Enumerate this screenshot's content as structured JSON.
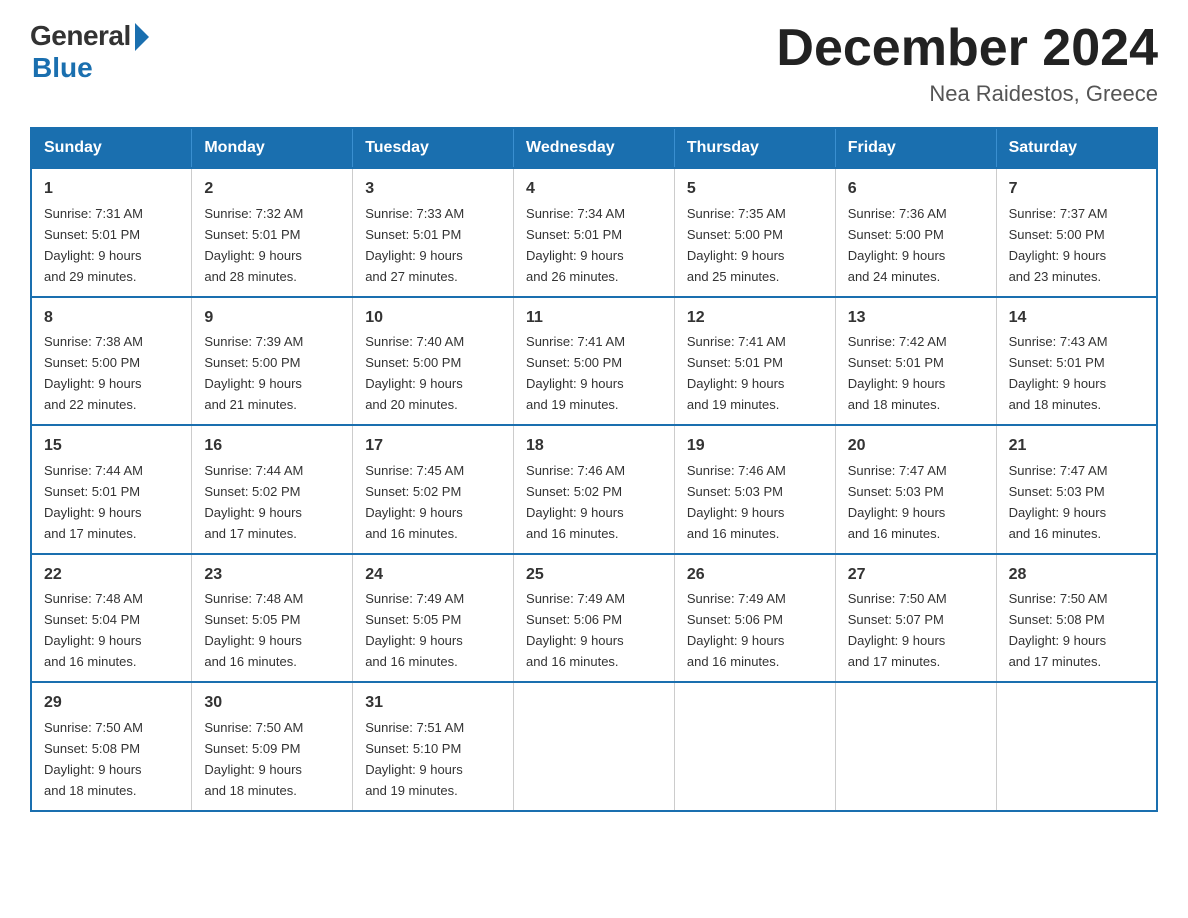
{
  "header": {
    "logo_general": "General",
    "logo_blue": "Blue",
    "month_title": "December 2024",
    "location": "Nea Raidestos, Greece"
  },
  "weekdays": [
    "Sunday",
    "Monday",
    "Tuesday",
    "Wednesday",
    "Thursday",
    "Friday",
    "Saturday"
  ],
  "weeks": [
    [
      {
        "day": "1",
        "sunrise": "7:31 AM",
        "sunset": "5:01 PM",
        "daylight": "9 hours and 29 minutes."
      },
      {
        "day": "2",
        "sunrise": "7:32 AM",
        "sunset": "5:01 PM",
        "daylight": "9 hours and 28 minutes."
      },
      {
        "day": "3",
        "sunrise": "7:33 AM",
        "sunset": "5:01 PM",
        "daylight": "9 hours and 27 minutes."
      },
      {
        "day": "4",
        "sunrise": "7:34 AM",
        "sunset": "5:01 PM",
        "daylight": "9 hours and 26 minutes."
      },
      {
        "day": "5",
        "sunrise": "7:35 AM",
        "sunset": "5:00 PM",
        "daylight": "9 hours and 25 minutes."
      },
      {
        "day": "6",
        "sunrise": "7:36 AM",
        "sunset": "5:00 PM",
        "daylight": "9 hours and 24 minutes."
      },
      {
        "day": "7",
        "sunrise": "7:37 AM",
        "sunset": "5:00 PM",
        "daylight": "9 hours and 23 minutes."
      }
    ],
    [
      {
        "day": "8",
        "sunrise": "7:38 AM",
        "sunset": "5:00 PM",
        "daylight": "9 hours and 22 minutes."
      },
      {
        "day": "9",
        "sunrise": "7:39 AM",
        "sunset": "5:00 PM",
        "daylight": "9 hours and 21 minutes."
      },
      {
        "day": "10",
        "sunrise": "7:40 AM",
        "sunset": "5:00 PM",
        "daylight": "9 hours and 20 minutes."
      },
      {
        "day": "11",
        "sunrise": "7:41 AM",
        "sunset": "5:00 PM",
        "daylight": "9 hours and 19 minutes."
      },
      {
        "day": "12",
        "sunrise": "7:41 AM",
        "sunset": "5:01 PM",
        "daylight": "9 hours and 19 minutes."
      },
      {
        "day": "13",
        "sunrise": "7:42 AM",
        "sunset": "5:01 PM",
        "daylight": "9 hours and 18 minutes."
      },
      {
        "day": "14",
        "sunrise": "7:43 AM",
        "sunset": "5:01 PM",
        "daylight": "9 hours and 18 minutes."
      }
    ],
    [
      {
        "day": "15",
        "sunrise": "7:44 AM",
        "sunset": "5:01 PM",
        "daylight": "9 hours and 17 minutes."
      },
      {
        "day": "16",
        "sunrise": "7:44 AM",
        "sunset": "5:02 PM",
        "daylight": "9 hours and 17 minutes."
      },
      {
        "day": "17",
        "sunrise": "7:45 AM",
        "sunset": "5:02 PM",
        "daylight": "9 hours and 16 minutes."
      },
      {
        "day": "18",
        "sunrise": "7:46 AM",
        "sunset": "5:02 PM",
        "daylight": "9 hours and 16 minutes."
      },
      {
        "day": "19",
        "sunrise": "7:46 AM",
        "sunset": "5:03 PM",
        "daylight": "9 hours and 16 minutes."
      },
      {
        "day": "20",
        "sunrise": "7:47 AM",
        "sunset": "5:03 PM",
        "daylight": "9 hours and 16 minutes."
      },
      {
        "day": "21",
        "sunrise": "7:47 AM",
        "sunset": "5:03 PM",
        "daylight": "9 hours and 16 minutes."
      }
    ],
    [
      {
        "day": "22",
        "sunrise": "7:48 AM",
        "sunset": "5:04 PM",
        "daylight": "9 hours and 16 minutes."
      },
      {
        "day": "23",
        "sunrise": "7:48 AM",
        "sunset": "5:05 PM",
        "daylight": "9 hours and 16 minutes."
      },
      {
        "day": "24",
        "sunrise": "7:49 AM",
        "sunset": "5:05 PM",
        "daylight": "9 hours and 16 minutes."
      },
      {
        "day": "25",
        "sunrise": "7:49 AM",
        "sunset": "5:06 PM",
        "daylight": "9 hours and 16 minutes."
      },
      {
        "day": "26",
        "sunrise": "7:49 AM",
        "sunset": "5:06 PM",
        "daylight": "9 hours and 16 minutes."
      },
      {
        "day": "27",
        "sunrise": "7:50 AM",
        "sunset": "5:07 PM",
        "daylight": "9 hours and 17 minutes."
      },
      {
        "day": "28",
        "sunrise": "7:50 AM",
        "sunset": "5:08 PM",
        "daylight": "9 hours and 17 minutes."
      }
    ],
    [
      {
        "day": "29",
        "sunrise": "7:50 AM",
        "sunset": "5:08 PM",
        "daylight": "9 hours and 18 minutes."
      },
      {
        "day": "30",
        "sunrise": "7:50 AM",
        "sunset": "5:09 PM",
        "daylight": "9 hours and 18 minutes."
      },
      {
        "day": "31",
        "sunrise": "7:51 AM",
        "sunset": "5:10 PM",
        "daylight": "9 hours and 19 minutes."
      },
      null,
      null,
      null,
      null
    ]
  ],
  "labels": {
    "sunrise": "Sunrise:",
    "sunset": "Sunset:",
    "daylight": "Daylight:"
  }
}
